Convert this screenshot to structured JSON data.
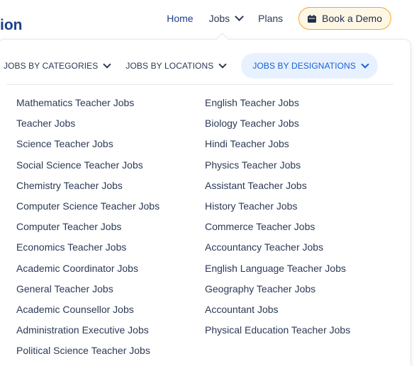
{
  "header": {
    "logo_fragment": "ion",
    "nav": {
      "home": "Home",
      "jobs": "Jobs",
      "plans": "Plans",
      "book_demo": "Book a Demo"
    }
  },
  "colors": {
    "brand": "#1b3f8b",
    "active_tab_bg": "#e8f1ff",
    "active_tab_text": "#1560d6",
    "demo_border": "#f5a623",
    "demo_bg": "#fff7e6"
  },
  "dropdown": {
    "tabs": [
      {
        "label": "JOBS BY CATEGORIES",
        "active": false
      },
      {
        "label": "JOBS BY LOCATIONS",
        "active": false
      },
      {
        "label": "JOBS BY DESIGNATIONS",
        "active": true
      }
    ],
    "left_column": [
      "Mathematics Teacher Jobs",
      "Teacher Jobs",
      "Science Teacher Jobs",
      "Social Science Teacher Jobs",
      "Chemistry Teacher Jobs",
      "Computer Science Teacher Jobs",
      "Computer Teacher Jobs",
      "Economics Teacher Jobs",
      "Academic Coordinator Jobs",
      "General Teacher Jobs",
      "Academic Counsellor Jobs",
      "Administration Executive Jobs",
      "Political Science Teacher Jobs"
    ],
    "right_column": [
      "English Teacher Jobs",
      "Biology Teacher Jobs",
      "Hindi Teacher Jobs",
      "Physics Teacher Jobs",
      "Assistant Teacher Jobs",
      "History Teacher Jobs",
      "Commerce Teacher Jobs",
      "Accountancy Teacher Jobs",
      "English Language Teacher Jobs",
      "Geography Teacher Jobs",
      "Accountant Jobs",
      "Physical Education Teacher Jobs"
    ]
  }
}
